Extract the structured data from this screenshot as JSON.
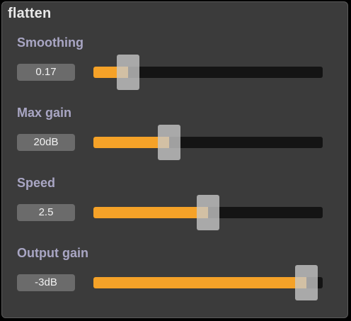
{
  "window": {
    "title": "flatten"
  },
  "params": [
    {
      "label": "Smoothing",
      "value_text": "0.17",
      "level": 0.15
    },
    {
      "label": "Max gain",
      "value_text": "20dB",
      "level": 0.33
    },
    {
      "label": "Speed",
      "value_text": "2.5",
      "level": 0.5
    },
    {
      "label": "Output gain",
      "value_text": "-3dB",
      "level": 0.93
    }
  ],
  "colors": {
    "panel_bg": "#3b3b3b",
    "label": "#a9a6c4",
    "fill": "#f5a228",
    "track": "#141414",
    "value_box": "#6b6b6b"
  }
}
